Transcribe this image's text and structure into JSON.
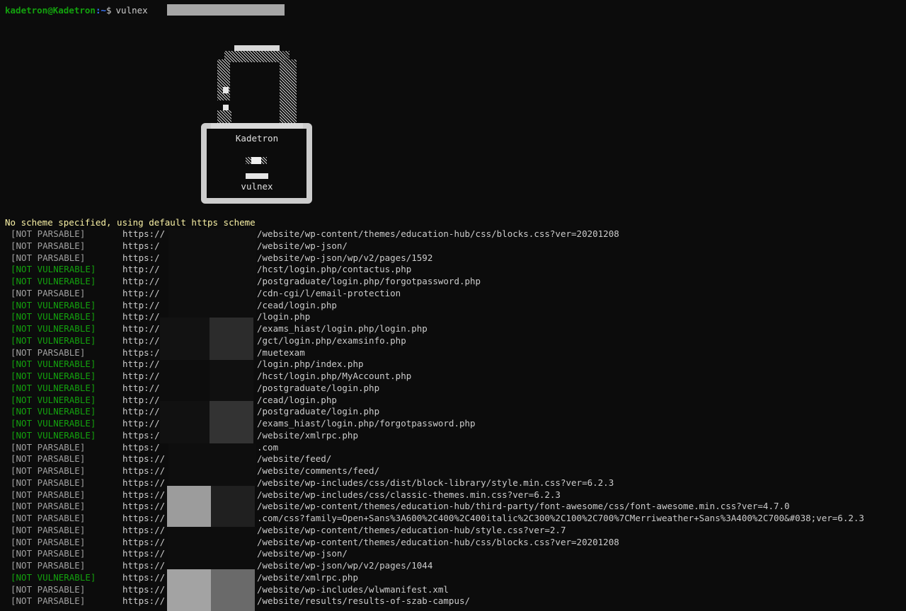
{
  "prompt": {
    "user_host": "kadetron@Kadetron",
    "path": ":~",
    "symbol": "$",
    "command": "vulnex"
  },
  "logo": {
    "title": "Kadetron",
    "subtitle": "vulnex"
  },
  "notice": "No scheme specified, using default https scheme",
  "results": [
    {
      "status": "[NOT PARSABLE]",
      "type": "parsable",
      "scheme": "https://",
      "path": "/website/wp-content/themes/education-hub/css/blocks.css?ver=20201208"
    },
    {
      "status": "[NOT PARSABLE]",
      "type": "parsable",
      "scheme": "https:/",
      "path": "/website/wp-json/"
    },
    {
      "status": "[NOT PARSABLE]",
      "type": "parsable",
      "scheme": "https:/",
      "path": "/website/wp-json/wp/v2/pages/1592"
    },
    {
      "status": "[NOT VULNERABLE]",
      "type": "notvuln",
      "scheme": "http://",
      "path": "/hcst/login.php/contactus.php"
    },
    {
      "status": "[NOT VULNERABLE]",
      "type": "notvuln",
      "scheme": "http://",
      "path": "/postgraduate/login.php/forgotpassword.php"
    },
    {
      "status": "[NOT PARSABLE]",
      "type": "parsable",
      "scheme": "http://",
      "path": "/cdn-cgi/l/email-protection"
    },
    {
      "status": "[NOT VULNERABLE]",
      "type": "notvuln",
      "scheme": "http://",
      "path": "/cead/login.php"
    },
    {
      "status": "[NOT VULNERABLE]",
      "type": "notvuln",
      "scheme": "http://",
      "path": "/login.php"
    },
    {
      "status": "[NOT VULNERABLE]",
      "type": "notvuln",
      "scheme": "http://",
      "path": "/exams_hiast/login.php/login.php"
    },
    {
      "status": "[NOT VULNERABLE]",
      "type": "notvuln",
      "scheme": "http://",
      "path": "/gct/login.php/examsinfo.php"
    },
    {
      "status": "[NOT PARSABLE]",
      "type": "parsable",
      "scheme": "https://",
      "path": "/muetexam"
    },
    {
      "status": "[NOT VULNERABLE]",
      "type": "notvuln",
      "scheme": "http://",
      "path": "/login.php/index.php"
    },
    {
      "status": "[NOT VULNERABLE]",
      "type": "notvuln",
      "scheme": "http://",
      "path": "/hcst/login.php/MyAccount.php"
    },
    {
      "status": "[NOT VULNERABLE]",
      "type": "notvuln",
      "scheme": "http://",
      "path": "/postgraduate/login.php"
    },
    {
      "status": "[NOT VULNERABLE]",
      "type": "notvuln",
      "scheme": "http://",
      "path": "/cead/login.php"
    },
    {
      "status": "[NOT VULNERABLE]",
      "type": "notvuln",
      "scheme": "http://",
      "path": "/postgraduate/login.php"
    },
    {
      "status": "[NOT VULNERABLE]",
      "type": "notvuln",
      "scheme": "http://",
      "path": "/exams_hiast/login.php/forgotpassword.php"
    },
    {
      "status": "[NOT VULNERABLE]",
      "type": "notvuln",
      "scheme": "https:/",
      "path": "/website/xmlrpc.php"
    },
    {
      "status": "[NOT PARSABLE]",
      "type": "parsable",
      "scheme": "https:/",
      "path": ".com"
    },
    {
      "status": "[NOT PARSABLE]",
      "type": "parsable",
      "scheme": "https://",
      "path": "/website/feed/"
    },
    {
      "status": "[NOT PARSABLE]",
      "type": "parsable",
      "scheme": "https://",
      "path": "/website/comments/feed/"
    },
    {
      "status": "[NOT PARSABLE]",
      "type": "parsable",
      "scheme": "https://",
      "path": "/website/wp-includes/css/dist/block-library/style.min.css?ver=6.2.3"
    },
    {
      "status": "[NOT PARSABLE]",
      "type": "parsable",
      "scheme": "https://",
      "path": "/website/wp-includes/css/classic-themes.min.css?ver=6.2.3"
    },
    {
      "status": "[NOT PARSABLE]",
      "type": "parsable",
      "scheme": "https://",
      "path": "/website/wp-content/themes/education-hub/third-party/font-awesome/css/font-awesome.min.css?ver=4.7.0"
    },
    {
      "status": "[NOT PARSABLE]",
      "type": "parsable",
      "scheme": "https://",
      "path": ".com/css?family=Open+Sans%3A600%2C400%2C400italic%2C300%2C100%2C700%7CMerriweather+Sans%3A400%2C700&#038;ver=6.2.3"
    },
    {
      "status": "[NOT PARSABLE]",
      "type": "parsable",
      "scheme": "https://",
      "path": "/website/wp-content/themes/education-hub/style.css?ver=2.7"
    },
    {
      "status": "[NOT PARSABLE]",
      "type": "parsable",
      "scheme": "https://",
      "path": "/website/wp-content/themes/education-hub/css/blocks.css?ver=20201208"
    },
    {
      "status": "[NOT PARSABLE]",
      "type": "parsable",
      "scheme": "https://",
      "path": "/website/wp-json/"
    },
    {
      "status": "[NOT PARSABLE]",
      "type": "parsable",
      "scheme": "https://",
      "path": "/website/wp-json/wp/v2/pages/1044"
    },
    {
      "status": "[NOT VULNERABLE]",
      "type": "notvuln",
      "scheme": "https://",
      "path": "/website/xmlrpc.php"
    },
    {
      "status": "[NOT PARSABLE]",
      "type": "parsable",
      "scheme": "https://",
      "path": "/website/wp-includes/wlwmanifest.xml"
    },
    {
      "status": "[NOT PARSABLE]",
      "type": "parsable",
      "scheme": "https://",
      "path": "/website/results/results-of-szab-campus/"
    }
  ],
  "colors": {
    "background": "#0c0c0c",
    "user_host": "#13a10e",
    "path": "#3b78ff",
    "notice": "#f9f1a5",
    "not_parsable": "#a0a0a0",
    "not_vulnerable": "#13a10e"
  }
}
